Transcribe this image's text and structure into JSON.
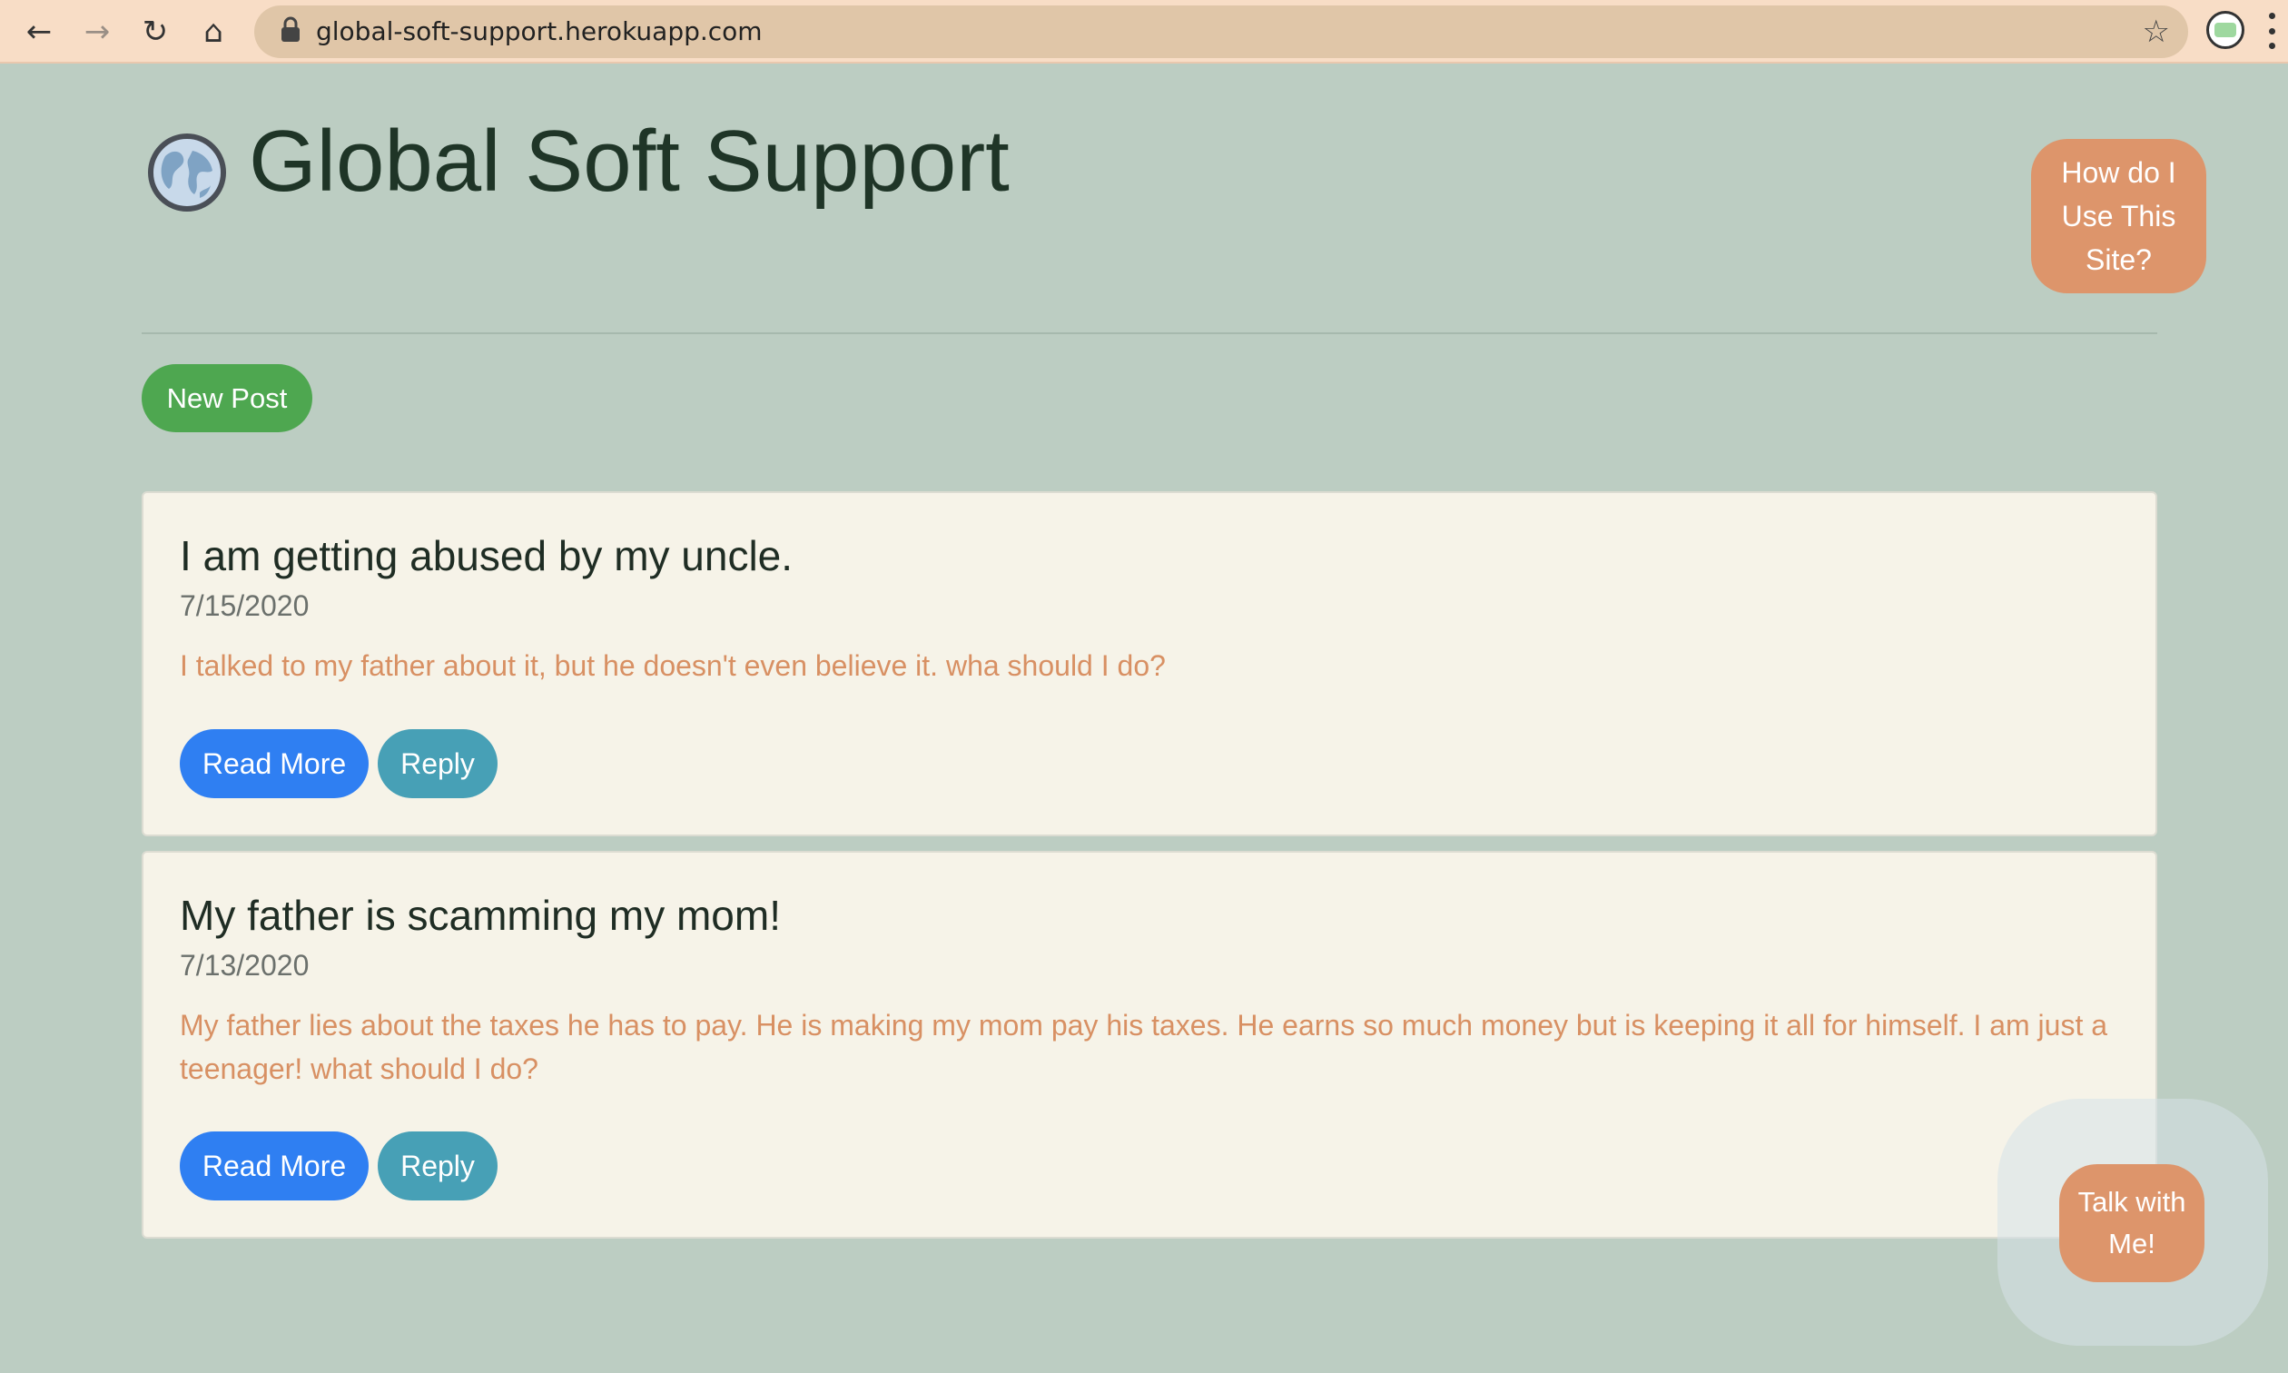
{
  "browser": {
    "back_icon": "←",
    "forward_icon": "→",
    "reload_icon": "↻",
    "home_icon": "⌂",
    "url": "global-soft-support.herokuapp.com",
    "bookmark_icon": "☆"
  },
  "header": {
    "title": "Global Soft Support",
    "help_button": "How do I Use This Site?"
  },
  "actions": {
    "new_post": "New Post"
  },
  "posts": [
    {
      "title": "I am getting abused by my uncle.",
      "date": "7/15/2020",
      "body": "I talked to my father about it, but he doesn't even believe it. wha should I do?",
      "read_more": "Read More",
      "reply": "Reply"
    },
    {
      "title": "My father is scamming my mom!",
      "date": "7/13/2020",
      "body": "My father lies about the taxes he has to pay. He is making my mom pay his taxes. He earns so much money but is keeping it all for himself. I am just a teenager! what should I do?",
      "read_more": "Read More",
      "reply": "Reply"
    }
  ],
  "chat": {
    "label": "Talk with Me!"
  },
  "colors": {
    "page_background": "#bccdc2",
    "accent_orange": "#dd956b",
    "new_post_green": "#4ea750",
    "read_more_blue": "#2f7ff2",
    "reply_teal": "#47a0b6",
    "card_background": "#f6f3e8",
    "post_body_text": "#d89063"
  }
}
